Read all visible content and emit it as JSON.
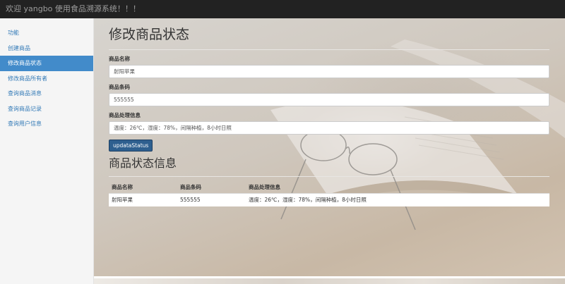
{
  "header": {
    "title": "欢迎 yangbo 使用食品溯源系统！！！"
  },
  "sidebar": {
    "items": [
      {
        "label": "功能",
        "active": false
      },
      {
        "label": "创建商品",
        "active": false
      },
      {
        "label": "修改商品状态",
        "active": true
      },
      {
        "label": "修改商品所有者",
        "active": false
      },
      {
        "label": "查询商品消息",
        "active": false
      },
      {
        "label": "查询商品记录",
        "active": false
      },
      {
        "label": "查询用户信息",
        "active": false
      }
    ]
  },
  "form": {
    "title": "修改商品状态",
    "name_label": "商品名称",
    "name_value": "射阳苹果",
    "barcode_label": "商品条码",
    "barcode_value": "555555",
    "info_label": "商品处理信息",
    "info_value": "温度：26℃，湿度：78%，间隔种植，8小时日照",
    "submit_label": "updataStatus"
  },
  "status": {
    "title": "商品状态信息",
    "columns": [
      "商品名称",
      "商品条码",
      "商品处理信息"
    ],
    "rows": [
      [
        "射阳苹果",
        "555555",
        "温度：26℃，湿度：78%，间隔种植，8小时日照"
      ]
    ]
  },
  "colors": {
    "topbar": "#222222",
    "active_nav": "#428bca",
    "link": "#337ab7",
    "button": "#2e5f8f"
  }
}
